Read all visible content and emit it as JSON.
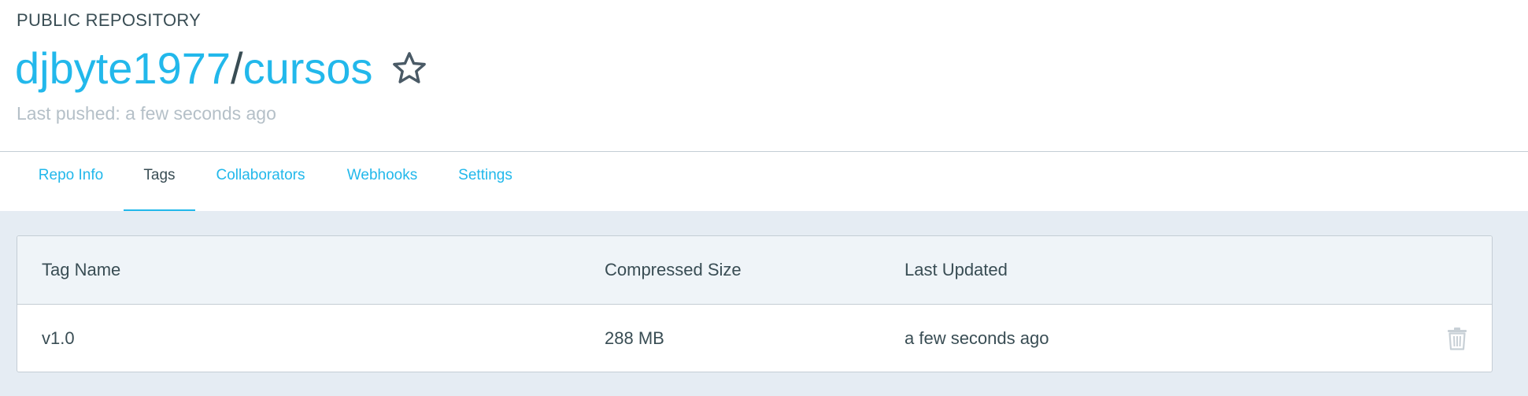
{
  "repo": {
    "visibility": "PUBLIC REPOSITORY",
    "owner": "djbyte1977",
    "separator": "/",
    "name": "cursos",
    "last_pushed": "Last pushed: a few seconds ago"
  },
  "tabs": [
    {
      "label": "Repo Info",
      "active": false
    },
    {
      "label": "Tags",
      "active": true
    },
    {
      "label": "Collaborators",
      "active": false
    },
    {
      "label": "Webhooks",
      "active": false
    },
    {
      "label": "Settings",
      "active": false
    }
  ],
  "tags_table": {
    "headers": {
      "tag_name": "Tag Name",
      "compressed_size": "Compressed Size",
      "last_updated": "Last Updated"
    },
    "rows": [
      {
        "tag_name": "v1.0",
        "compressed_size": "288 MB",
        "last_updated": "a few seconds ago"
      }
    ]
  },
  "icons": {
    "star": "star-outline-icon",
    "delete": "trash-icon"
  },
  "colors": {
    "accent": "#22b8eb",
    "text": "#394d54",
    "muted": "#b5c0c8",
    "page_background": "#e5ecf3",
    "table_header_background": "#eff4f8",
    "border": "#c4cdd5"
  }
}
